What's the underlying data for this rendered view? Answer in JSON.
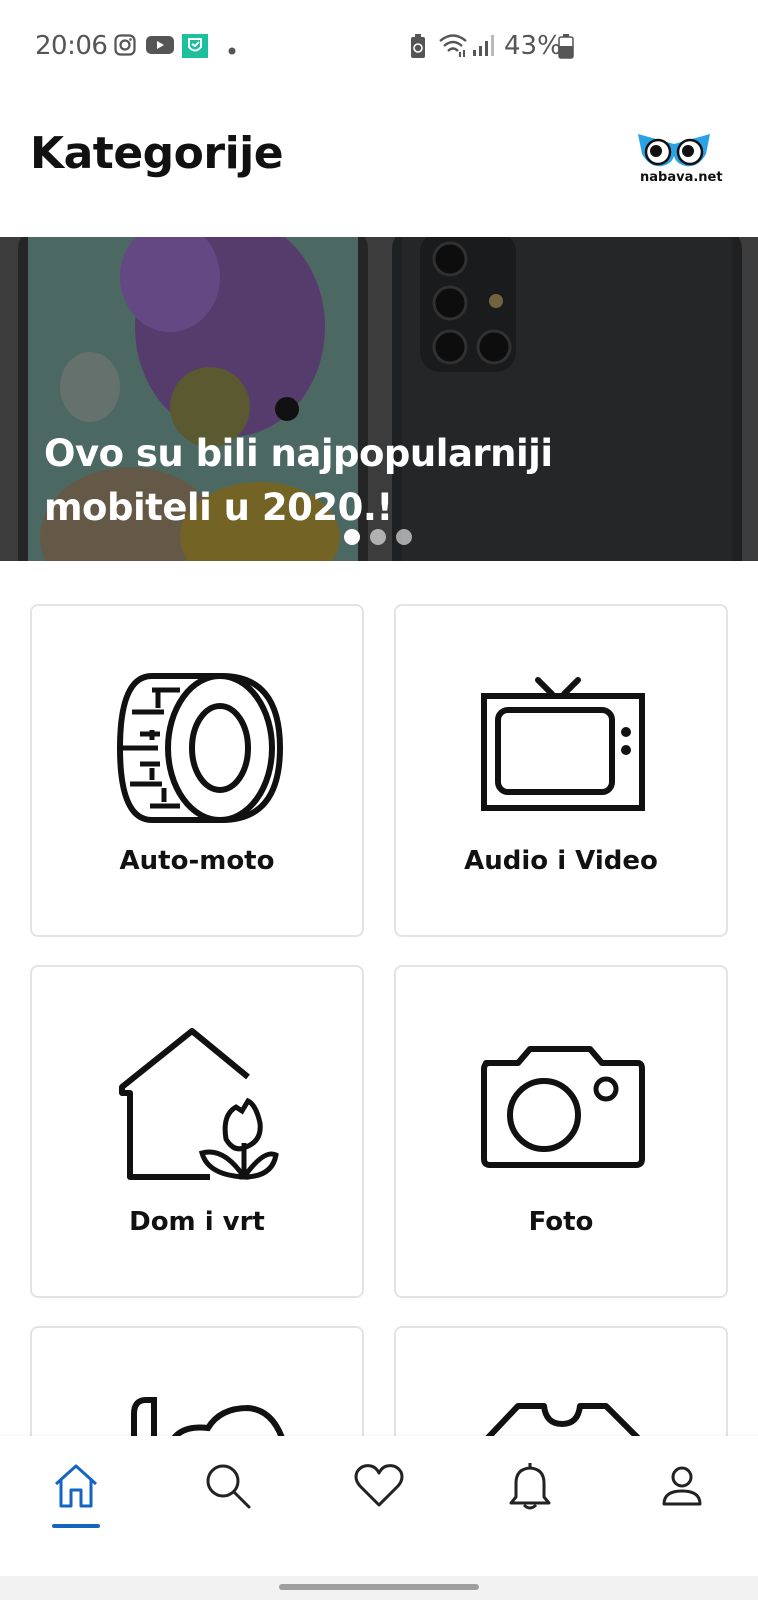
{
  "status_bar": {
    "time": "20:06",
    "battery": "43%"
  },
  "header": {
    "title": "Kategorije",
    "logo_text": "nabava.net",
    "logo_color": "#29a3e6"
  },
  "banner": {
    "title": "Ovo su bili najpopularniji mobiteli u 2020.!",
    "slide_count": 3,
    "active_slide": 1
  },
  "categories": [
    {
      "label": "Auto-moto",
      "icon": "tire-icon"
    },
    {
      "label": "Audio i Video",
      "icon": "tv-icon"
    },
    {
      "label": "Dom i vrt",
      "icon": "house-flower-icon"
    },
    {
      "label": "Foto",
      "icon": "camera-icon"
    },
    {
      "label": "",
      "icon": "toys-icon"
    },
    {
      "label": "",
      "icon": "clothing-icon"
    }
  ],
  "bottom_nav": {
    "items": [
      {
        "name": "home",
        "icon": "home-icon",
        "active": true
      },
      {
        "name": "search",
        "icon": "search-icon",
        "active": false
      },
      {
        "name": "favorites",
        "icon": "heart-icon",
        "active": false
      },
      {
        "name": "notifications",
        "icon": "bell-icon",
        "active": false
      },
      {
        "name": "profile",
        "icon": "user-icon",
        "active": false
      }
    ],
    "accent_color": "#1565c0"
  }
}
